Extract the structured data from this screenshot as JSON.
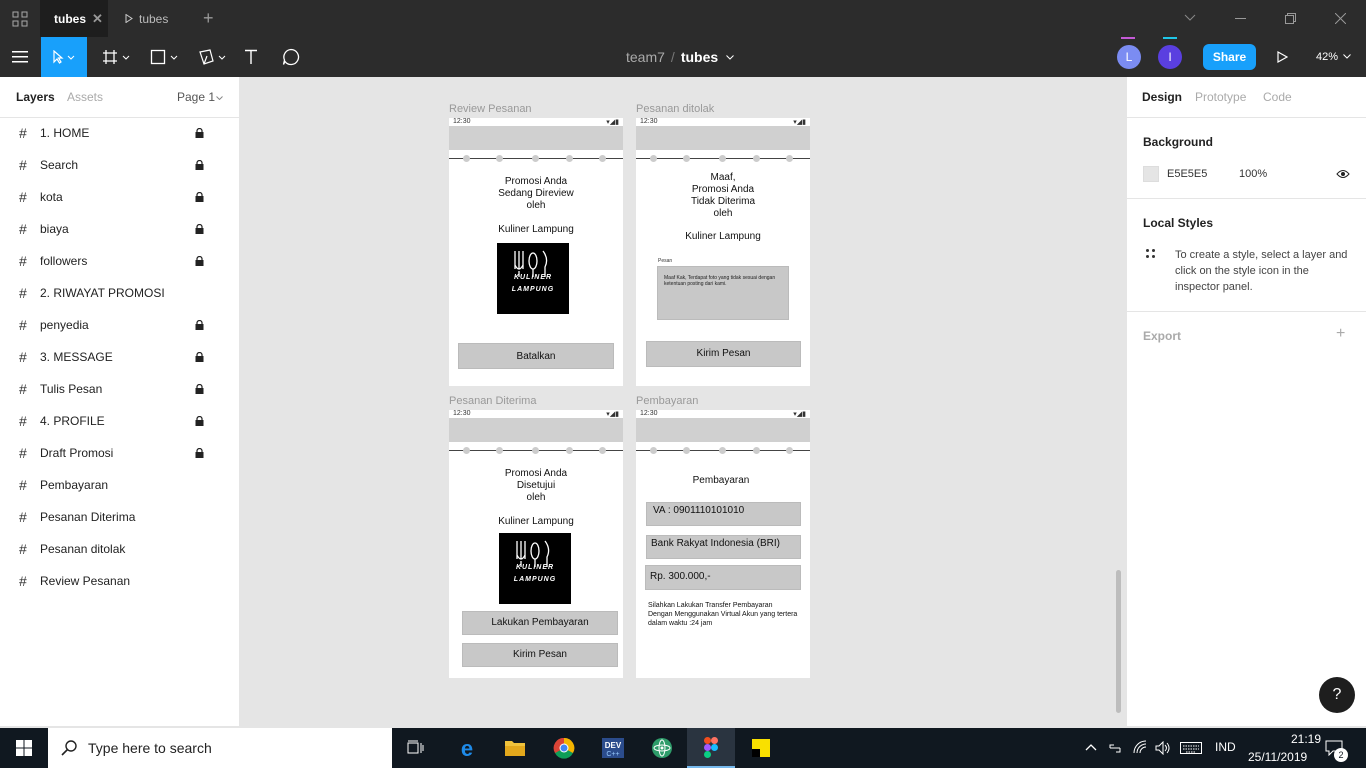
{
  "titlebar": {
    "tabs": [
      {
        "label": "tubes",
        "close": "✕"
      },
      {
        "label": "tubes"
      }
    ],
    "add_tab": "+"
  },
  "toolbar": {
    "breadcrumb": {
      "team": "team7",
      "separator": "/",
      "file": "tubes"
    },
    "avatars": [
      {
        "initial": "L",
        "color": "#7b8cf2"
      },
      {
        "initial": "I",
        "color": "#5a3fe0"
      }
    ],
    "share_label": "Share",
    "zoom": "42%"
  },
  "left_panel": {
    "tabs": {
      "layers": "Layers",
      "assets": "Assets"
    },
    "page": "Page 1",
    "layers": [
      {
        "name": "1. HOME",
        "locked": true
      },
      {
        "name": "Search",
        "locked": true
      },
      {
        "name": "kota",
        "locked": true
      },
      {
        "name": "biaya",
        "locked": true
      },
      {
        "name": "followers",
        "locked": true
      },
      {
        "name": "2. RIWAYAT PROMOSI",
        "locked": false
      },
      {
        "name": "penyedia",
        "locked": true
      },
      {
        "name": "3. MESSAGE",
        "locked": true
      },
      {
        "name": "Tulis Pesan",
        "locked": true
      },
      {
        "name": "4. PROFILE",
        "locked": true
      },
      {
        "name": "Draft Promosi",
        "locked": true
      },
      {
        "name": "Pembayaran",
        "locked": false
      },
      {
        "name": "Pesanan Diterima",
        "locked": false
      },
      {
        "name": "Pesanan ditolak",
        "locked": false
      },
      {
        "name": "Review Pesanan",
        "locked": false
      }
    ]
  },
  "canvas": {
    "status_time": "12:30",
    "logo_text_1": "KULINER",
    "logo_text_2": "LAMPUNG",
    "frames": {
      "review": {
        "label": "Review Pesanan",
        "line1": "Promosi Anda",
        "line2": "Sedang Direview",
        "line3": "oleh",
        "brand": "Kuliner Lampung",
        "button": "Batalkan"
      },
      "ditolak": {
        "label": "Pesanan ditolak",
        "line1": "Maaf,",
        "line2": "Promosi Anda",
        "line3": "Tidak Diterima",
        "line4": "oleh",
        "brand": "Kuliner Lampung",
        "pesan_label": "Pesan",
        "pesan_text": "Maaf Kak, Terdapat foto yang tidak sesuai dengan ketentuan posting dari kami.",
        "button": "Kirim Pesan"
      },
      "diterima": {
        "label": "Pesanan Diterima",
        "line1": "Promosi Anda",
        "line2": "Disetujui",
        "line3": "oleh",
        "brand": "Kuliner Lampung",
        "button1": "Lakukan Pembayaran",
        "button2": "Kirim Pesan"
      },
      "pembayaran": {
        "label": "Pembayaran",
        "title": "Pembayaran",
        "va": "VA : 0901110101010",
        "bank": "Bank Rakyat Indonesia (BRI)",
        "amount": "Rp. 300.000,-",
        "note": "Silahkan Lakukan Transfer Pembayaran Dengan Menggunakan Virtual Akun yang tertera dalam waktu :24 jam"
      }
    }
  },
  "right_panel": {
    "tabs": {
      "design": "Design",
      "prototype": "Prototype",
      "code": "Code"
    },
    "background": {
      "title": "Background",
      "hex": "E5E5E5",
      "opacity": "100%"
    },
    "local_styles": {
      "title": "Local Styles",
      "hint": "To create a style, select a layer and click on the style icon in the inspector panel."
    },
    "export": {
      "title": "Export",
      "add": "+"
    },
    "help": "?"
  },
  "taskbar": {
    "search_placeholder": "Type here to search",
    "lang": "IND",
    "time": "21:19",
    "date": "25/11/2019",
    "notifications": "2"
  },
  "colors": {
    "accent": "#18a0fb",
    "chrome": "#2c2c2c",
    "canvas": "#e5e5e5"
  }
}
